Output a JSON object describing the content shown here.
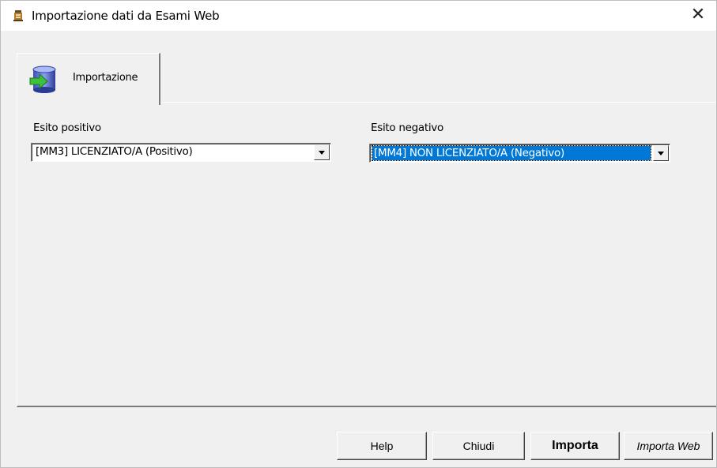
{
  "window": {
    "title": "Importazione dati da Esami Web",
    "close_glyph": "✕"
  },
  "tabs": [
    {
      "label": "Importazione",
      "icon": "database-import-icon"
    }
  ],
  "form": {
    "positive": {
      "label": "Esito positivo",
      "value": "[MM3] LICENZIATO/A (Positivo)"
    },
    "negative": {
      "label": "Esito negativo",
      "value": "[MM4] NON LICENZIATO/A (Negativo)"
    }
  },
  "buttons": {
    "help": "Help",
    "close": "Chiudi",
    "import": "Importa",
    "import_web": "Importa Web"
  },
  "colors": {
    "selection": "#0078d7",
    "window_bg": "#f0f0f0"
  }
}
